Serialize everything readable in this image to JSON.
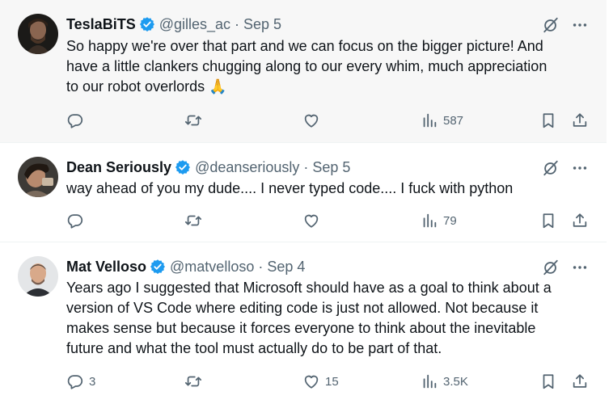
{
  "tweets": [
    {
      "name": "TeslaBiTS",
      "handle": "@gilles_ac",
      "dot": "·",
      "date": "Sep 5",
      "lines": [
        "So happy we're over that part and we can focus on the bigger picture! And",
        "have a little clankers chugging along to our every whim, much appreciation",
        "to our robot overlords 🙏"
      ],
      "replies": "",
      "retweets": "",
      "likes": "",
      "views": "587"
    },
    {
      "name": "Dean Seriously",
      "handle": "@deanseriously",
      "dot": "·",
      "date": "Sep 5",
      "lines": [
        "way ahead of you my dude.... I never typed code.... I fuck with python"
      ],
      "replies": "",
      "retweets": "",
      "likes": "",
      "views": "79"
    },
    {
      "name": "Mat Velloso",
      "handle": "@matvelloso",
      "dot": "·",
      "date": "Sep 4",
      "lines": [
        "Years ago I suggested that Microsoft should have as a goal to think about a",
        "version of VS Code where editing code is just not allowed. Not because it",
        "makes sense but because it forces everyone to think about the inevitable",
        "future and what the tool must actually do to be part of that."
      ],
      "replies": "3",
      "retweets": "",
      "likes": "15",
      "views": "3.5K"
    }
  ],
  "colors": {
    "text": "#0f1419",
    "muted": "#536471",
    "verified": "#1d9bf0",
    "highlight_bg": "#f7f7f7"
  },
  "icons": {
    "verified": "verified-badge-icon",
    "grok": "grok-icon",
    "more": "more-icon",
    "reply": "reply-icon",
    "retweet": "retweet-icon",
    "like": "like-icon",
    "views": "views-icon",
    "bookmark": "bookmark-icon",
    "share": "share-icon"
  }
}
